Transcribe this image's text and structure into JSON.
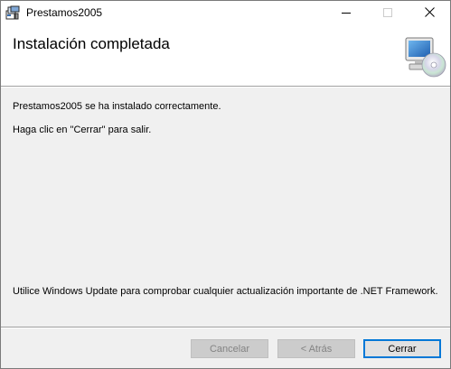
{
  "window": {
    "title": "Prestamos2005",
    "icon": "installer-app-icon",
    "controls": {
      "minimize_icon": "minimize-icon",
      "maximize_icon": "maximize-icon",
      "close_icon": "close-icon"
    }
  },
  "banner": {
    "title": "Instalación completada",
    "icon": "computer-cd-icon"
  },
  "body": {
    "line1": "Prestamos2005 se ha instalado correctamente.",
    "line2": "Haga clic en \"Cerrar\" para salir.",
    "line3": "Utilice Windows Update para comprobar cualquier actualización importante de .NET Framework."
  },
  "buttons": {
    "cancel": {
      "label": "Cancelar",
      "enabled": false
    },
    "back": {
      "label": "< Atrás",
      "enabled": false
    },
    "close": {
      "label": "Cerrar",
      "enabled": true,
      "default": true
    }
  },
  "colors": {
    "accent": "#0078d7",
    "window_bg": "#f0f0f0",
    "banner_bg": "#ffffff"
  }
}
